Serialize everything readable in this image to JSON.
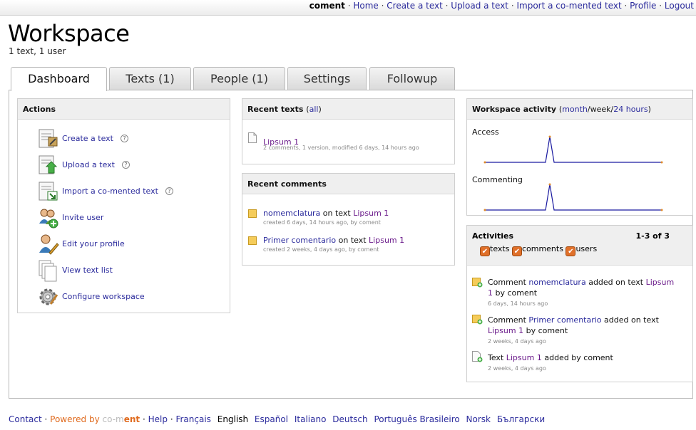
{
  "topbar": {
    "username": "coment",
    "links": [
      "Home",
      "Create a text",
      "Upload a text",
      "Import a co-mented text",
      "Profile",
      "Logout"
    ]
  },
  "header": {
    "title": "Workspace",
    "subtitle": "1 text, 1 user"
  },
  "tabs": [
    "Dashboard",
    "Texts (1)",
    "People (1)",
    "Settings",
    "Followup"
  ],
  "actions": {
    "title": "Actions",
    "items": [
      {
        "label": "Create a text",
        "icon": "create-text-icon",
        "help": "?"
      },
      {
        "label": "Upload a text",
        "icon": "upload-text-icon",
        "help": "?"
      },
      {
        "label": "Import a co-mented text",
        "icon": "import-text-icon",
        "help": "?"
      },
      {
        "label": "Invite user",
        "icon": "invite-user-icon"
      },
      {
        "label": "Edit your profile",
        "icon": "edit-profile-icon"
      },
      {
        "label": "View text list",
        "icon": "text-list-icon"
      },
      {
        "label": "Configure workspace",
        "icon": "gear-icon"
      }
    ]
  },
  "recent_texts": {
    "title": "Recent texts",
    "all_label": "all",
    "items": [
      {
        "title": "Lipsum 1",
        "meta": "2 comments, 1 version, modified 6 days, 14 hours ago"
      }
    ]
  },
  "recent_comments": {
    "title": "Recent comments",
    "on_text": "on text",
    "items": [
      {
        "title": "nomemclatura",
        "text": "Lipsum 1",
        "meta": "created 6 days, 14 hours ago, by coment"
      },
      {
        "title": "Primer comentario",
        "text": "Lipsum 1",
        "meta": "created 2 weeks, 4 days ago, by coment"
      }
    ]
  },
  "workspace_activity": {
    "title": "Workspace activity",
    "periods": [
      "month",
      "week",
      "24 hours"
    ],
    "charts": [
      "Access",
      "Commenting"
    ]
  },
  "activities": {
    "title": "Activities",
    "range": "1-3 of 3",
    "filters": [
      "texts",
      "comments",
      "users"
    ],
    "a1": {
      "pre": "Comment",
      "link": "nomemclatura",
      "mid": "added on text",
      "link2": "Lipsum 1",
      "post": "by coment",
      "time": "6 days, 14 hours ago"
    },
    "a2": {
      "pre": "Comment",
      "link": "Primer comentario",
      "mid": "added on text",
      "link2": "Lipsum 1",
      "post": "by coment",
      "time": "2 weeks, 4 days ago"
    },
    "a3": {
      "pre": "Text",
      "link": "Lipsum 1",
      "post": "added by coment",
      "time": "2 weeks, 4 days ago"
    }
  },
  "footer": {
    "contact": "Contact",
    "powered": "Powered by",
    "brand_a": "co-m",
    "brand_b": "ent",
    "help": "Help",
    "languages": [
      "Français",
      "English",
      "Español",
      "Italiano",
      "Deutsch",
      "Português Brasileiro",
      "Norsk",
      "Български"
    ]
  },
  "colors": {
    "link": "#2a2a9c",
    "visited": "#6a1a8a",
    "chart_line": "#1a1aa0",
    "chart_point": "#e08a2a",
    "brand": "#e06b1f"
  }
}
